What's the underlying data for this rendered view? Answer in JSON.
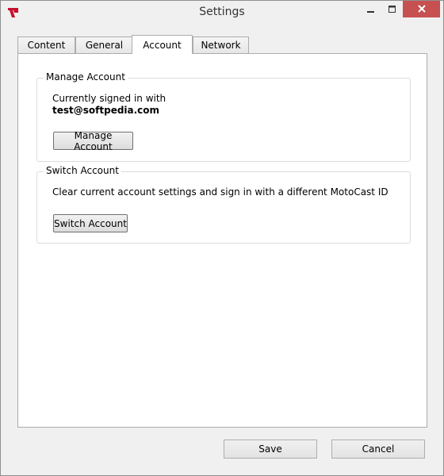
{
  "window": {
    "title": "Settings"
  },
  "tabs": [
    {
      "label": "Content",
      "active": false
    },
    {
      "label": "General",
      "active": false
    },
    {
      "label": "Account",
      "active": true
    },
    {
      "label": "Network",
      "active": false
    }
  ],
  "manage_account": {
    "title": "Manage Account",
    "signed_in_label": "Currently signed in with",
    "email": "test@softpedia.com",
    "button_label": "Manage Account"
  },
  "switch_account": {
    "title": "Switch Account",
    "description": "Clear current account settings and sign in with a different MotoCast ID",
    "button_label": "Switch Account"
  },
  "footer": {
    "save_label": "Save",
    "cancel_label": "Cancel"
  },
  "colors": {
    "close_button": "#c75050",
    "window_bg": "#f0f0f0",
    "panel_bg": "#ffffff"
  }
}
